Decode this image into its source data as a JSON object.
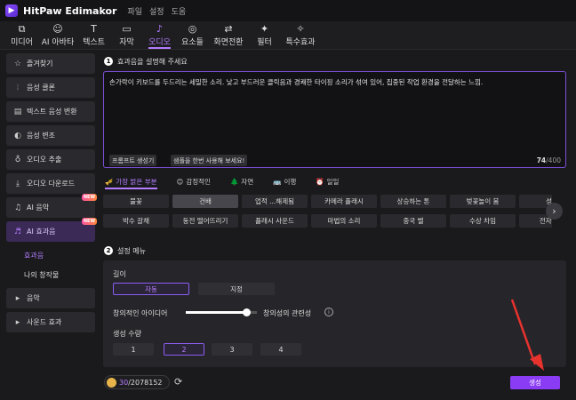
{
  "app": {
    "title": "HitPaw Edimakor",
    "menu": [
      "파일",
      "설정",
      "도움"
    ]
  },
  "toolbar": [
    {
      "label": "미디어",
      "icon": "folder-icon"
    },
    {
      "label": "AI 아바타",
      "icon": "avatar-icon"
    },
    {
      "label": "텍스트",
      "icon": "text-icon"
    },
    {
      "label": "자막",
      "icon": "subtitle-icon"
    },
    {
      "label": "오디오",
      "icon": "audio-icon",
      "active": true
    },
    {
      "label": "요소들",
      "icon": "elements-icon"
    },
    {
      "label": "화면전환",
      "icon": "transition-icon"
    },
    {
      "label": "필터",
      "icon": "filter-icon"
    },
    {
      "label": "특수효과",
      "icon": "effects-icon"
    }
  ],
  "sidebar": {
    "items": [
      {
        "label": "즐겨찾기",
        "icon": "star-icon"
      },
      {
        "label": "음성 클론",
        "icon": "waveform-icon"
      },
      {
        "label": "텍스트 음성 변환",
        "icon": "text-to-speech-icon"
      },
      {
        "label": "음성 변조",
        "icon": "voice-changer-icon"
      },
      {
        "label": "오디오 추출",
        "icon": "mic-icon"
      },
      {
        "label": "오디오 다운로드",
        "icon": "download-icon"
      },
      {
        "label": "AI 음악",
        "icon": "music-note-icon",
        "badge": "NEW"
      },
      {
        "label": "AI 효과음",
        "icon": "sound-effect-icon",
        "badge": "NEW",
        "active": true
      }
    ],
    "subitems": [
      {
        "label": "효과음",
        "active": true
      },
      {
        "label": "나의 창작물"
      }
    ],
    "items2": [
      {
        "label": "음악",
        "icon": "chevron-right-icon"
      },
      {
        "label": "사운드 효과",
        "icon": "chevron-right-icon"
      }
    ]
  },
  "section1": {
    "number": "1",
    "title": "효과음을 설명해 주세요",
    "prompt": "손가락이 키보드를 두드리는 세밀한 소리. 낮고 부드러운 클릭음과 경쾌한 타이핑 소리가 섞여 있어, 집중된 작업 환경을 전달하는 느낌.",
    "btn_generate_prompt": "프롬프트 생성기",
    "btn_try_sample": "샘플을 한번 사용해 보세요!",
    "count_current": "74",
    "count_max": "/400"
  },
  "categories": [
    {
      "icon": "🎺",
      "label": "가장 밝은 부분",
      "active": true
    },
    {
      "icon": "😊",
      "label": "감정적인"
    },
    {
      "icon": "🌲",
      "label": "자연"
    },
    {
      "icon": "🚌",
      "label": "이행"
    },
    {
      "icon": "⏰",
      "label": "일일"
    }
  ],
  "tags_row1": [
    "불꽃",
    "건배",
    "업적 ...해제됨",
    "카메라 플래시",
    "상승하는 톤",
    "벚꽃놀이 붐",
    "성공"
  ],
  "tags_row2": [
    "박수 갈채",
    "동전 떨어뜨리기",
    "플래시 사운드",
    "마법의 소리",
    "중국 벨",
    "수상 차임",
    "전자식 B"
  ],
  "section2": {
    "number": "2",
    "title": "설정 메뉴",
    "length_label": "길이",
    "length_options": [
      "자동",
      "지정"
    ],
    "creative_label": "창의적인 아이디어",
    "relevance_label": "창의성의 관련성",
    "slider_value": 0.85,
    "count_label": "생성 수량",
    "count_options": [
      "1",
      "2",
      "3",
      "4"
    ],
    "count_selected": "2"
  },
  "bottom": {
    "credits_used": "30",
    "credits_total": "/2078152",
    "generate_label": "생성"
  },
  "colors": {
    "accent": "#8a3cf5",
    "annotation_arrow": "#e8322e"
  }
}
